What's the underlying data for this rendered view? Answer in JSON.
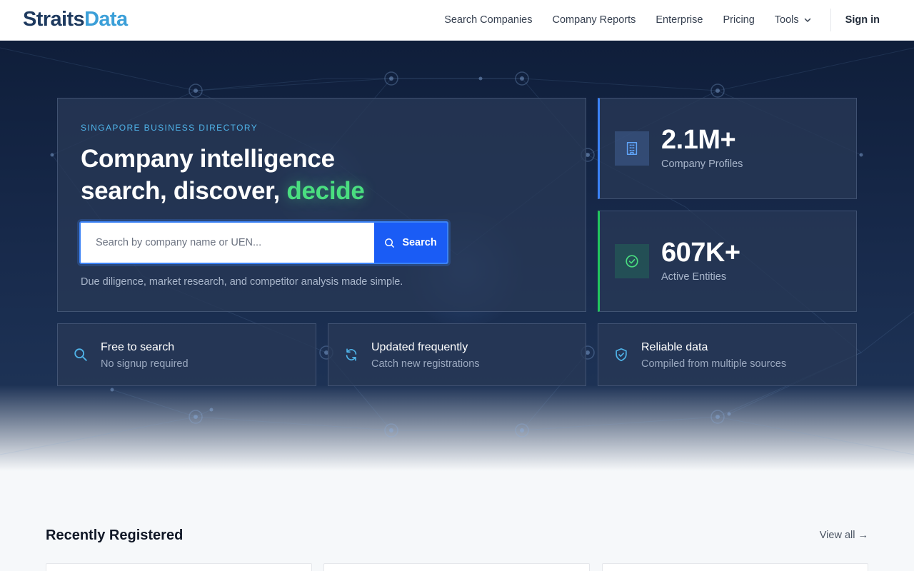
{
  "header": {
    "logo_part1": "Straits",
    "logo_part2": "Data",
    "nav": {
      "search_companies": "Search Companies",
      "company_reports": "Company Reports",
      "enterprise": "Enterprise",
      "pricing": "Pricing",
      "tools": "Tools"
    },
    "sign_in": "Sign in"
  },
  "hero": {
    "eyebrow": "SINGAPORE BUSINESS DIRECTORY",
    "headline_line1": "Company intelligence",
    "headline_line2": "search, discover, ",
    "headline_accent": "decide",
    "search": {
      "placeholder": "Search by company name or UEN...",
      "value": "",
      "button_label": "Search"
    },
    "tagline": "Due diligence, market research, and competitor analysis made simple."
  },
  "stats": [
    {
      "value": "2.1M+",
      "label": "Company Profiles",
      "icon": "building-icon",
      "accent": "#3b82f6"
    },
    {
      "value": "607K+",
      "label": "Active Entities",
      "icon": "check-circle-icon",
      "accent": "#22c55e"
    }
  ],
  "features": [
    {
      "title": "Free to search",
      "subtitle": "No signup required",
      "icon": "search-icon"
    },
    {
      "title": "Updated frequently",
      "subtitle": "Catch new registrations",
      "icon": "refresh-icon"
    },
    {
      "title": "Reliable data",
      "subtitle": "Compiled from multiple sources",
      "icon": "shield-check-icon"
    }
  ],
  "recent": {
    "title": "Recently Registered",
    "view_all": "View all →"
  },
  "colors": {
    "brand_dark": "#1e3a5f",
    "brand_light": "#3b9fd8",
    "primary_button": "#1a5cf5",
    "accent_green": "#4ade80",
    "hero_background": "#17294a"
  }
}
